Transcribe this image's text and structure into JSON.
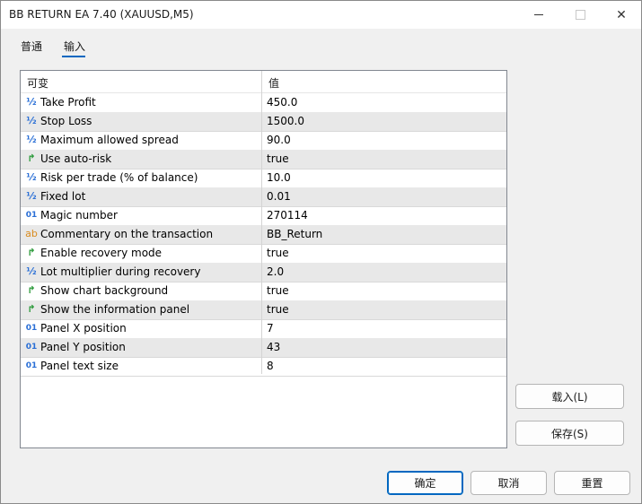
{
  "window": {
    "title": "BB RETURN EA 7.40 (XAUUSD,M5)",
    "close_glyph": "✕"
  },
  "tabs": [
    {
      "label": "普通"
    },
    {
      "label": "输入"
    }
  ],
  "grid": {
    "col_variable": "可变",
    "col_value": "值",
    "rows": [
      {
        "icon": "½",
        "name": "Take Profit",
        "value": "450.0"
      },
      {
        "icon": "½",
        "name": "Stop Loss",
        "value": "1500.0"
      },
      {
        "icon": "½",
        "name": "Maximum allowed spread",
        "value": "90.0"
      },
      {
        "icon": "↱",
        "name": "Use auto-risk",
        "value": "true"
      },
      {
        "icon": "½",
        "name": "Risk per trade (% of balance)",
        "value": "10.0"
      },
      {
        "icon": "½",
        "name": "Fixed lot",
        "value": "0.01"
      },
      {
        "icon": "01",
        "name": "Magic number",
        "value": "270114"
      },
      {
        "icon": "ab",
        "name": "Commentary on the transaction",
        "value": "BB_Return"
      },
      {
        "icon": "↱",
        "name": "Enable recovery mode",
        "value": "true"
      },
      {
        "icon": "½",
        "name": "Lot multiplier during recovery",
        "value": "2.0"
      },
      {
        "icon": "↱",
        "name": "Show chart background",
        "value": "true"
      },
      {
        "icon": "↱",
        "name": "Show the information panel",
        "value": "true"
      },
      {
        "icon": "01",
        "name": "Panel X position",
        "value": "7"
      },
      {
        "icon": "01",
        "name": "Panel Y position",
        "value": "43"
      },
      {
        "icon": "01",
        "name": "Panel text size",
        "value": "8"
      }
    ]
  },
  "side_buttons": {
    "load": "载入(L)",
    "save": "保存(S)"
  },
  "footer": {
    "ok": "确定",
    "cancel": "取消",
    "reset": "重置"
  }
}
